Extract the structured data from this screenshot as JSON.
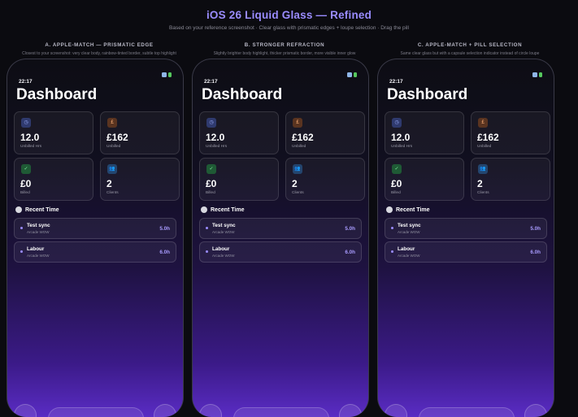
{
  "header": {
    "title": "iOS 26 Liquid Glass — Refined",
    "subtitle": "Based on your reference screenshot · Clear glass with prismatic edges + loupe selection · Drag the pill"
  },
  "variants": [
    {
      "heading": "A. APPLE-MATCH — PRISMATIC EDGE",
      "description": "Closest to your screenshot: very clear body, rainbow-tinted border, subtle top highlight"
    },
    {
      "heading": "B. STRONGER REFRACTION",
      "description": "Slightly brighter body highlight, thicker prismatic border, more visible inner glow"
    },
    {
      "heading": "C. APPLE-MATCH + PILL SELECTION",
      "description": "Same clear glass but with a capsule selection indicator instead of circle loupe"
    }
  ],
  "phone": {
    "time": "22:17",
    "title": "Dashboard",
    "stats": [
      {
        "icon": "clock-icon",
        "glyph": "◷",
        "value": "12.0",
        "label": "Unbilled Hrs"
      },
      {
        "icon": "pound-icon",
        "glyph": "£",
        "value": "£162",
        "label": "Unbilled"
      },
      {
        "icon": "check-icon",
        "glyph": "✓",
        "value": "£0",
        "label": "Billed"
      },
      {
        "icon": "people-icon",
        "glyph": "👥",
        "value": "2",
        "label": "Clients"
      }
    ],
    "recent_title": "Recent Time",
    "entries": [
      {
        "title": "Test sync",
        "client": "Arcade WOW",
        "hours": "5.0h"
      },
      {
        "title": "Labour",
        "client": "Arcade WOW",
        "hours": "6.0h"
      }
    ]
  },
  "colors": {
    "accent": "#9a8cff",
    "background": "#0b0b10",
    "gradient_bottom": "#5a2cc4"
  }
}
